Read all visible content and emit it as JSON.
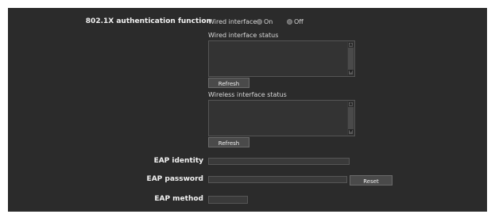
{
  "auth": {
    "function_label": "802.1X authentication function",
    "wired_interface_label": "Wired interface",
    "radio_on_label": "On",
    "radio_off_label": "Off",
    "selected": "none"
  },
  "wired_status": {
    "label": "Wired interface status",
    "value": "",
    "refresh_label": "Refresh"
  },
  "wireless_status": {
    "label": "Wireless interface status",
    "value": "",
    "refresh_label": "Refresh"
  },
  "eap": {
    "identity_label": "EAP identity",
    "identity_value": "",
    "password_label": "EAP password",
    "password_value": "",
    "reset_label": "Reset",
    "method_label": "EAP method",
    "method_value": ""
  },
  "colors": {
    "panel_bg": "#2b2b2b",
    "label_text": "#f2f2f2",
    "field_bg": "#3a3a3a"
  },
  "icons": [
    "scroll-up-icon",
    "scroll-down-icon"
  ]
}
